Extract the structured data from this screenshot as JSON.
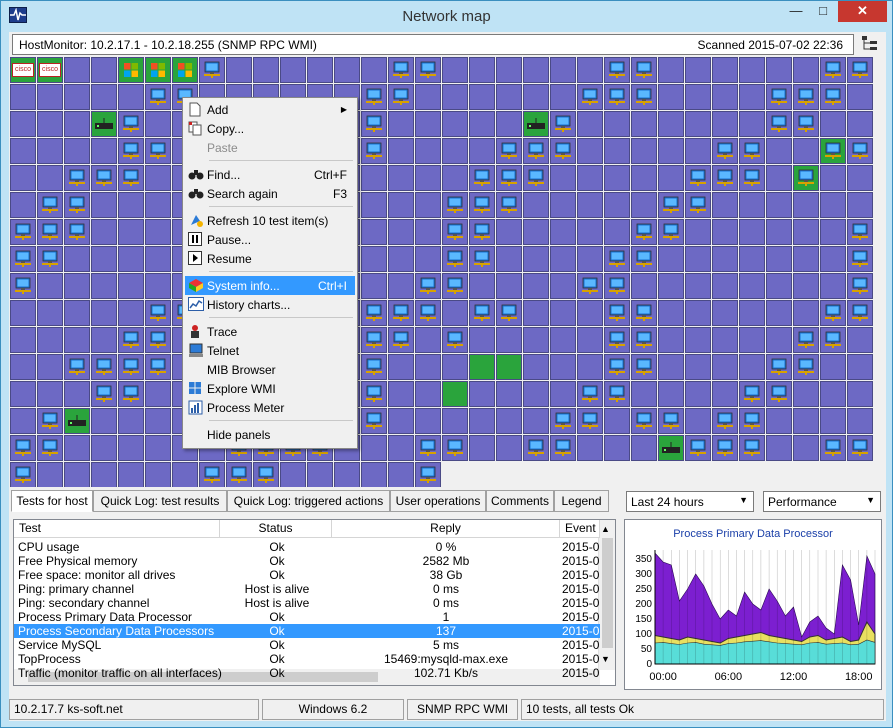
{
  "window": {
    "title": "Network map",
    "minimize": "—",
    "maximize": "□",
    "close": "✕"
  },
  "infobar": {
    "left": "HostMonitor: 10.2.17.1 - 10.2.18.255  (SNMP RPC WMI)",
    "right": "Scanned 2015-07-02 22:36"
  },
  "context_menu": {
    "items": [
      {
        "label": "Add",
        "shortcut": "",
        "icon": "add-icon",
        "submenu": "▶"
      },
      {
        "label": "Copy...",
        "shortcut": "",
        "icon": "copy-icon"
      },
      {
        "label": "Paste",
        "shortcut": "",
        "icon": "",
        "disabled": true
      },
      {
        "label": "Find...",
        "shortcut": "Ctrl+F",
        "icon": "binoculars-icon"
      },
      {
        "label": "Search again",
        "shortcut": "F3",
        "icon": "binoculars-icon"
      },
      {
        "label": "Refresh 10 test item(s)",
        "shortcut": "",
        "icon": "refresh-icon"
      },
      {
        "label": "Pause...",
        "shortcut": "",
        "icon": "pause-icon"
      },
      {
        "label": "Resume",
        "shortcut": "",
        "icon": "play-icon"
      },
      {
        "label": "System info...",
        "shortcut": "Ctrl+I",
        "icon": "system-info-icon",
        "highlighted": true
      },
      {
        "label": "History charts...",
        "shortcut": "",
        "icon": "chart-icon"
      },
      {
        "label": "Trace",
        "shortcut": "",
        "icon": "trace-icon"
      },
      {
        "label": "Telnet",
        "shortcut": "",
        "icon": "telnet-icon"
      },
      {
        "label": "MIB Browser",
        "shortcut": "",
        "icon": ""
      },
      {
        "label": "Explore WMI",
        "shortcut": "",
        "icon": "windows-icon"
      },
      {
        "label": "Process Meter",
        "shortcut": "",
        "icon": "process-meter-icon"
      },
      {
        "label": "Hide panels",
        "shortcut": "",
        "icon": ""
      }
    ]
  },
  "tabs": [
    "Tests for host",
    "Quick Log: test results",
    "Quick Log: triggered actions",
    "User operations",
    "Comments",
    "Legend"
  ],
  "period_select": {
    "value": "Last 24 hours"
  },
  "mode_select": {
    "value": "Performance"
  },
  "log": {
    "columns": [
      "Test",
      "Status",
      "Reply",
      "Event"
    ],
    "rows": [
      [
        "CPU usage",
        "Ok",
        "0 %",
        "2015-0"
      ],
      [
        "Free Physical memory",
        "Ok",
        "2582 Mb",
        "2015-0"
      ],
      [
        "Free space: monitor all drives",
        "Ok",
        "38 Gb",
        "2015-0"
      ],
      [
        "Ping: primary channel",
        "Host is alive",
        "0 ms",
        "2015-0"
      ],
      [
        "Ping: secondary channel",
        "Host is alive",
        "0 ms",
        "2015-0"
      ],
      [
        "Process Primary Data Processor",
        "Ok",
        "1",
        "2015-0"
      ],
      [
        "Process Secondary Data Processors",
        "Ok",
        "137",
        "2015-0"
      ],
      [
        "Service MySQL",
        "Ok",
        "5 ms",
        "2015-0"
      ],
      [
        "TopProcess",
        "Ok",
        "15469:mysqld-max.exe",
        "2015-0"
      ],
      [
        "Traffic (monitor traffic on all interfaces)",
        "Ok",
        "102.71 Kb/s",
        "2015-0"
      ]
    ],
    "selected_row": 6
  },
  "chart_data": {
    "type": "area",
    "title": "Process Primary Data Processor",
    "xlabel": "",
    "ylabel": "",
    "x_ticks": [
      "00:00",
      "06:00",
      "12:00",
      "18:00"
    ],
    "y_ticks": [
      0,
      50,
      100,
      150,
      200,
      250,
      300,
      350
    ],
    "ylim": [
      0,
      380
    ],
    "series": [
      {
        "values": [
          370,
          340,
          330,
          210,
          250,
          300,
          260,
          200,
          150,
          180,
          160,
          240,
          200,
          180,
          250,
          210,
          160,
          190,
          90,
          140,
          160,
          120,
          100,
          330,
          280,
          130,
          360,
          300
        ]
      },
      {
        "values": [
          95,
          90,
          85,
          80,
          90,
          85,
          80,
          75,
          70,
          85,
          90,
          95,
          100,
          105,
          95,
          90,
          85,
          80,
          75,
          90,
          95,
          80,
          85,
          90,
          75,
          80,
          140,
          100
        ]
      },
      {
        "values": [
          70,
          72,
          68,
          65,
          70,
          72,
          66,
          64,
          62,
          68,
          70,
          74,
          76,
          78,
          74,
          70,
          68,
          66,
          64,
          70,
          72,
          66,
          68,
          70,
          64,
          66,
          80,
          72
        ]
      }
    ],
    "colors": [
      "#7c1fd0",
      "#e8e060",
      "#58ddd8"
    ]
  },
  "status": [
    "10.2.17.7  ks-soft.net",
    "Windows 6.2",
    "SNMP RPC WMI",
    "10 tests, all tests Ok"
  ]
}
